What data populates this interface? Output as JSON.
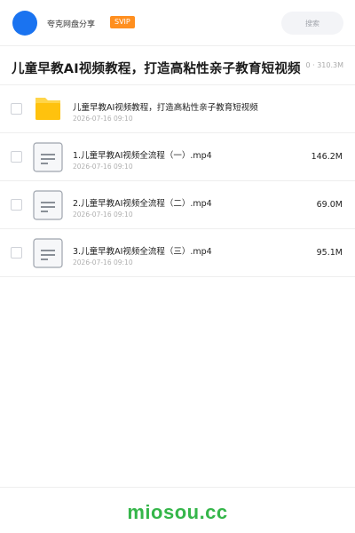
{
  "header": {
    "brand": "夸克网盘分享",
    "badge": "SVIP",
    "search_placeholder": "搜索"
  },
  "share": {
    "title": "儿童早教AI视频教程，打造高粘性亲子教育短视频",
    "meta": "0 · 310.3M"
  },
  "files": [
    {
      "type": "folder",
      "name": "儿童早教AI视频教程，打造高粘性亲子教育短视频",
      "date": "2026-07-16 09:10",
      "size": ""
    },
    {
      "type": "file",
      "name": "1.儿童早教AI视频全流程（一）.mp4",
      "date": "2026-07-16 09:10",
      "size": "146.2M"
    },
    {
      "type": "file",
      "name": "2.儿童早教AI视频全流程（二）.mp4",
      "date": "2026-07-16 09:10",
      "size": "69.0M"
    },
    {
      "type": "file",
      "name": "3.儿童早教AI视频全流程（三）.mp4",
      "date": "2026-07-16 09:10",
      "size": "95.1M"
    }
  ],
  "footer": {
    "watermark": "miosou.cc"
  },
  "colors": {
    "accent": "#1a73f0",
    "badge": "#ff8f1f",
    "folder": "#ffc20e",
    "watermark": "#35b64a"
  }
}
